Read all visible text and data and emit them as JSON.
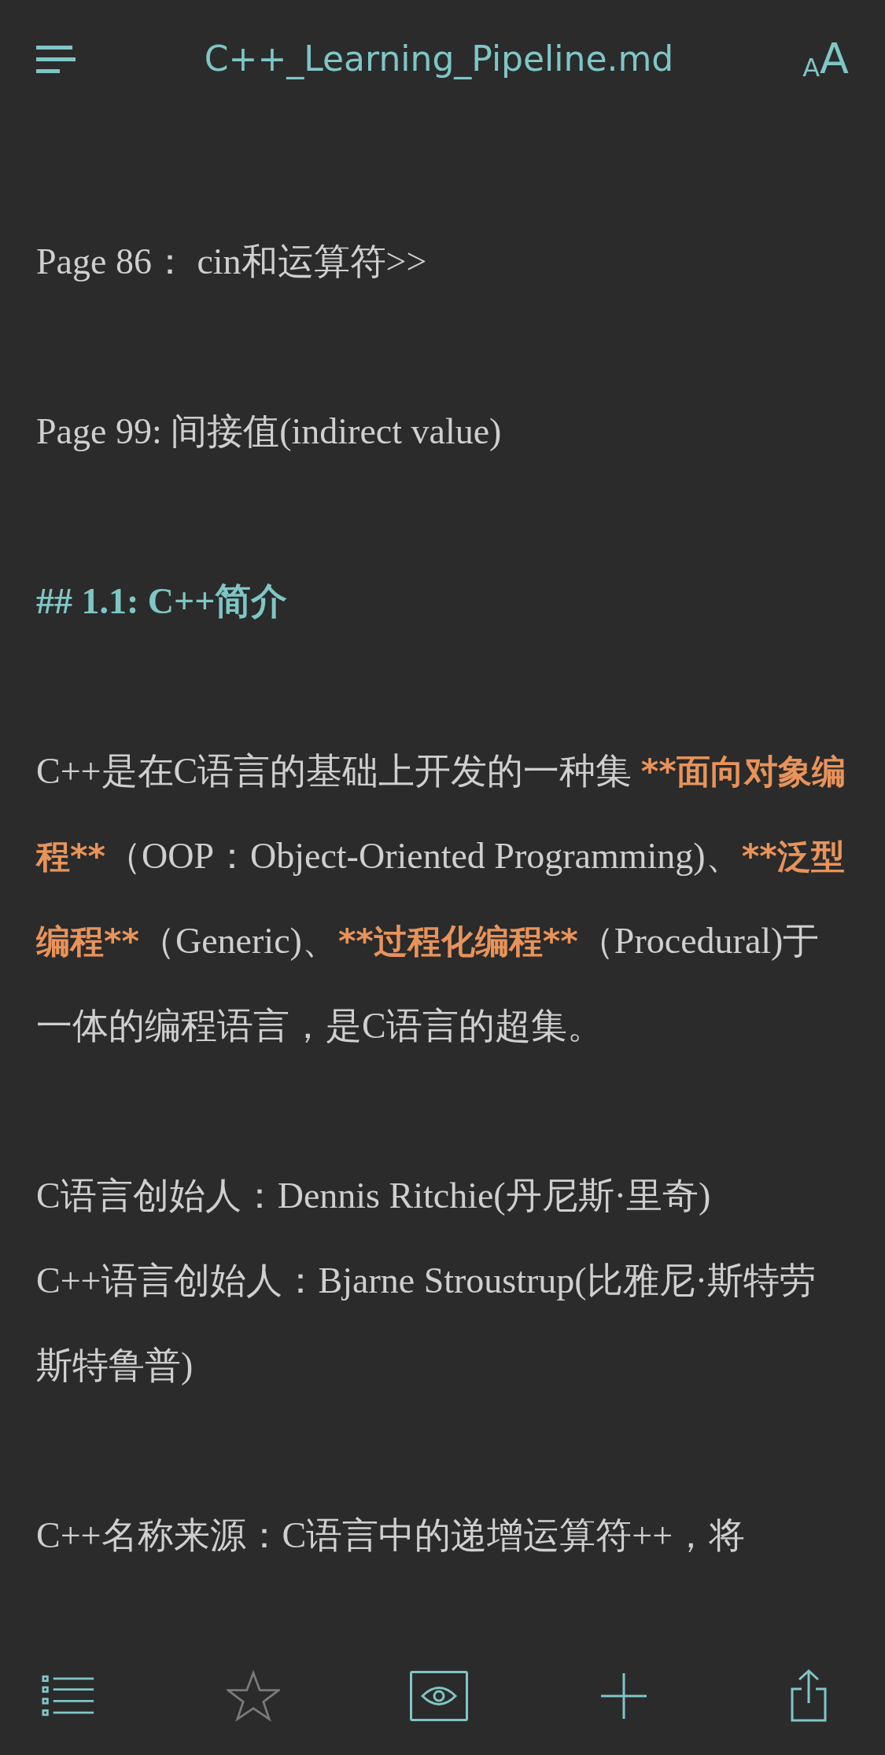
{
  "header": {
    "title": "C++_Learning_Pipeline.md",
    "font_button": "AA"
  },
  "blocks": [
    {
      "kind": "text",
      "lines": [
        [
          {
            "kind": "plain",
            "text": "Page 86： cin和运算符>>"
          }
        ]
      ]
    },
    {
      "kind": "text",
      "lines": [
        [
          {
            "kind": "plain",
            "text": "Page 99:  间接值(indirect value)"
          }
        ]
      ]
    },
    {
      "kind": "heading",
      "lines": [
        [
          {
            "kind": "plain",
            "text": "## 1.1:  C++简介"
          }
        ]
      ]
    },
    {
      "kind": "text",
      "lines": [
        [
          {
            "kind": "plain",
            "text": "C++是在C语言的基础上开发的一种集 "
          },
          {
            "kind": "strong",
            "text": "**面向对象编程**"
          },
          {
            "kind": "plain",
            "text": "（OOP：Object-Oriented Programming)、"
          },
          {
            "kind": "strong",
            "text": "**泛型编程**"
          },
          {
            "kind": "plain",
            "text": "（Generic)、"
          },
          {
            "kind": "strong",
            "text": "**过程化编程**"
          },
          {
            "kind": "plain",
            "text": "（Procedural)于一体的编程语言，是C语言的超集。"
          }
        ]
      ]
    },
    {
      "kind": "text",
      "lines": [
        [
          {
            "kind": "plain",
            "text": "C语言创始人：Dennis Ritchie(丹尼斯·里奇)"
          }
        ],
        [
          {
            "kind": "plain",
            "text": "C++语言创始人：Bjarne Stroustrup(比雅尼·斯特劳斯特鲁普)"
          }
        ]
      ]
    },
    {
      "kind": "text",
      "lines": [
        [
          {
            "kind": "plain",
            "text": "C++名称来源：C语言中的递增运算符++，将"
          }
        ]
      ]
    }
  ],
  "toolbar": [
    {
      "kind": "list",
      "selected": false
    },
    {
      "kind": "star",
      "selected": false
    },
    {
      "kind": "eye",
      "selected": true
    },
    {
      "kind": "plus",
      "selected": false
    },
    {
      "kind": "share",
      "selected": false
    }
  ]
}
